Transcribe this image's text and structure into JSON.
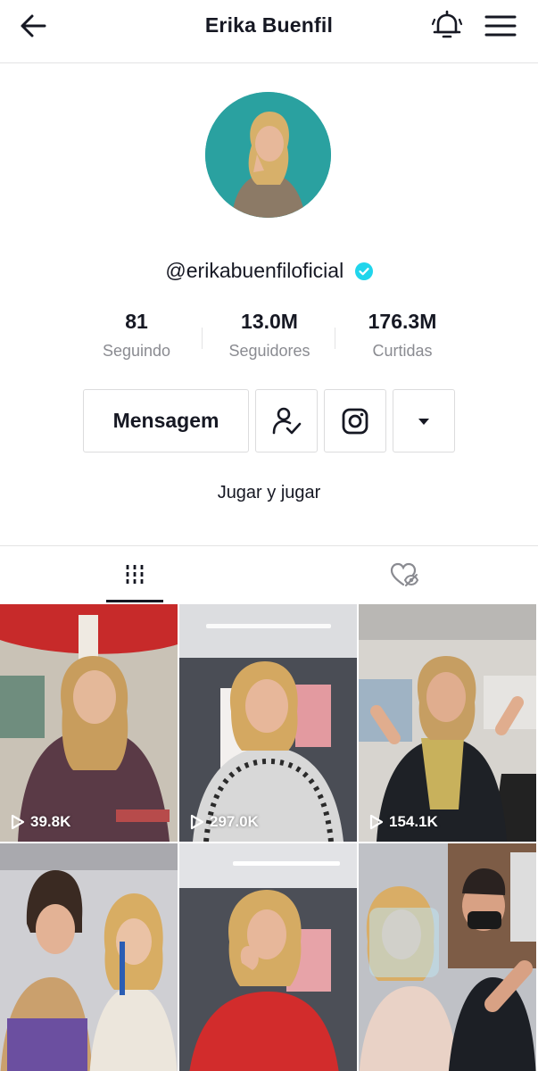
{
  "header": {
    "title": "Erika Buenfil",
    "back_icon": "arrow-left-icon",
    "bell_icon": "bell-icon",
    "menu_icon": "hamburger-menu-icon"
  },
  "profile": {
    "handle": "@erikabuenfiloficial",
    "verified_icon": "verified-badge-icon",
    "verified_color": "#20d5ec",
    "avatar_bg": "#2aa1a0"
  },
  "stats": [
    {
      "value": "81",
      "label": "Seguindo"
    },
    {
      "value": "13.0M",
      "label": "Seguidores"
    },
    {
      "value": "176.3M",
      "label": "Curtidas"
    }
  ],
  "actions": {
    "message_label": "Mensagem",
    "follow_icon": "following-check-icon",
    "instagram_icon": "instagram-icon",
    "more_icon": "dropdown-caret-icon"
  },
  "bio": "Jugar y jugar",
  "tabs": {
    "videos_icon": "grid-videos-icon",
    "liked_icon": "liked-hidden-icon"
  },
  "videos": [
    {
      "views": "39.8K"
    },
    {
      "views": "297.0K"
    },
    {
      "views": "154.1K"
    },
    {
      "views": ""
    },
    {
      "views": ""
    },
    {
      "views": ""
    }
  ]
}
